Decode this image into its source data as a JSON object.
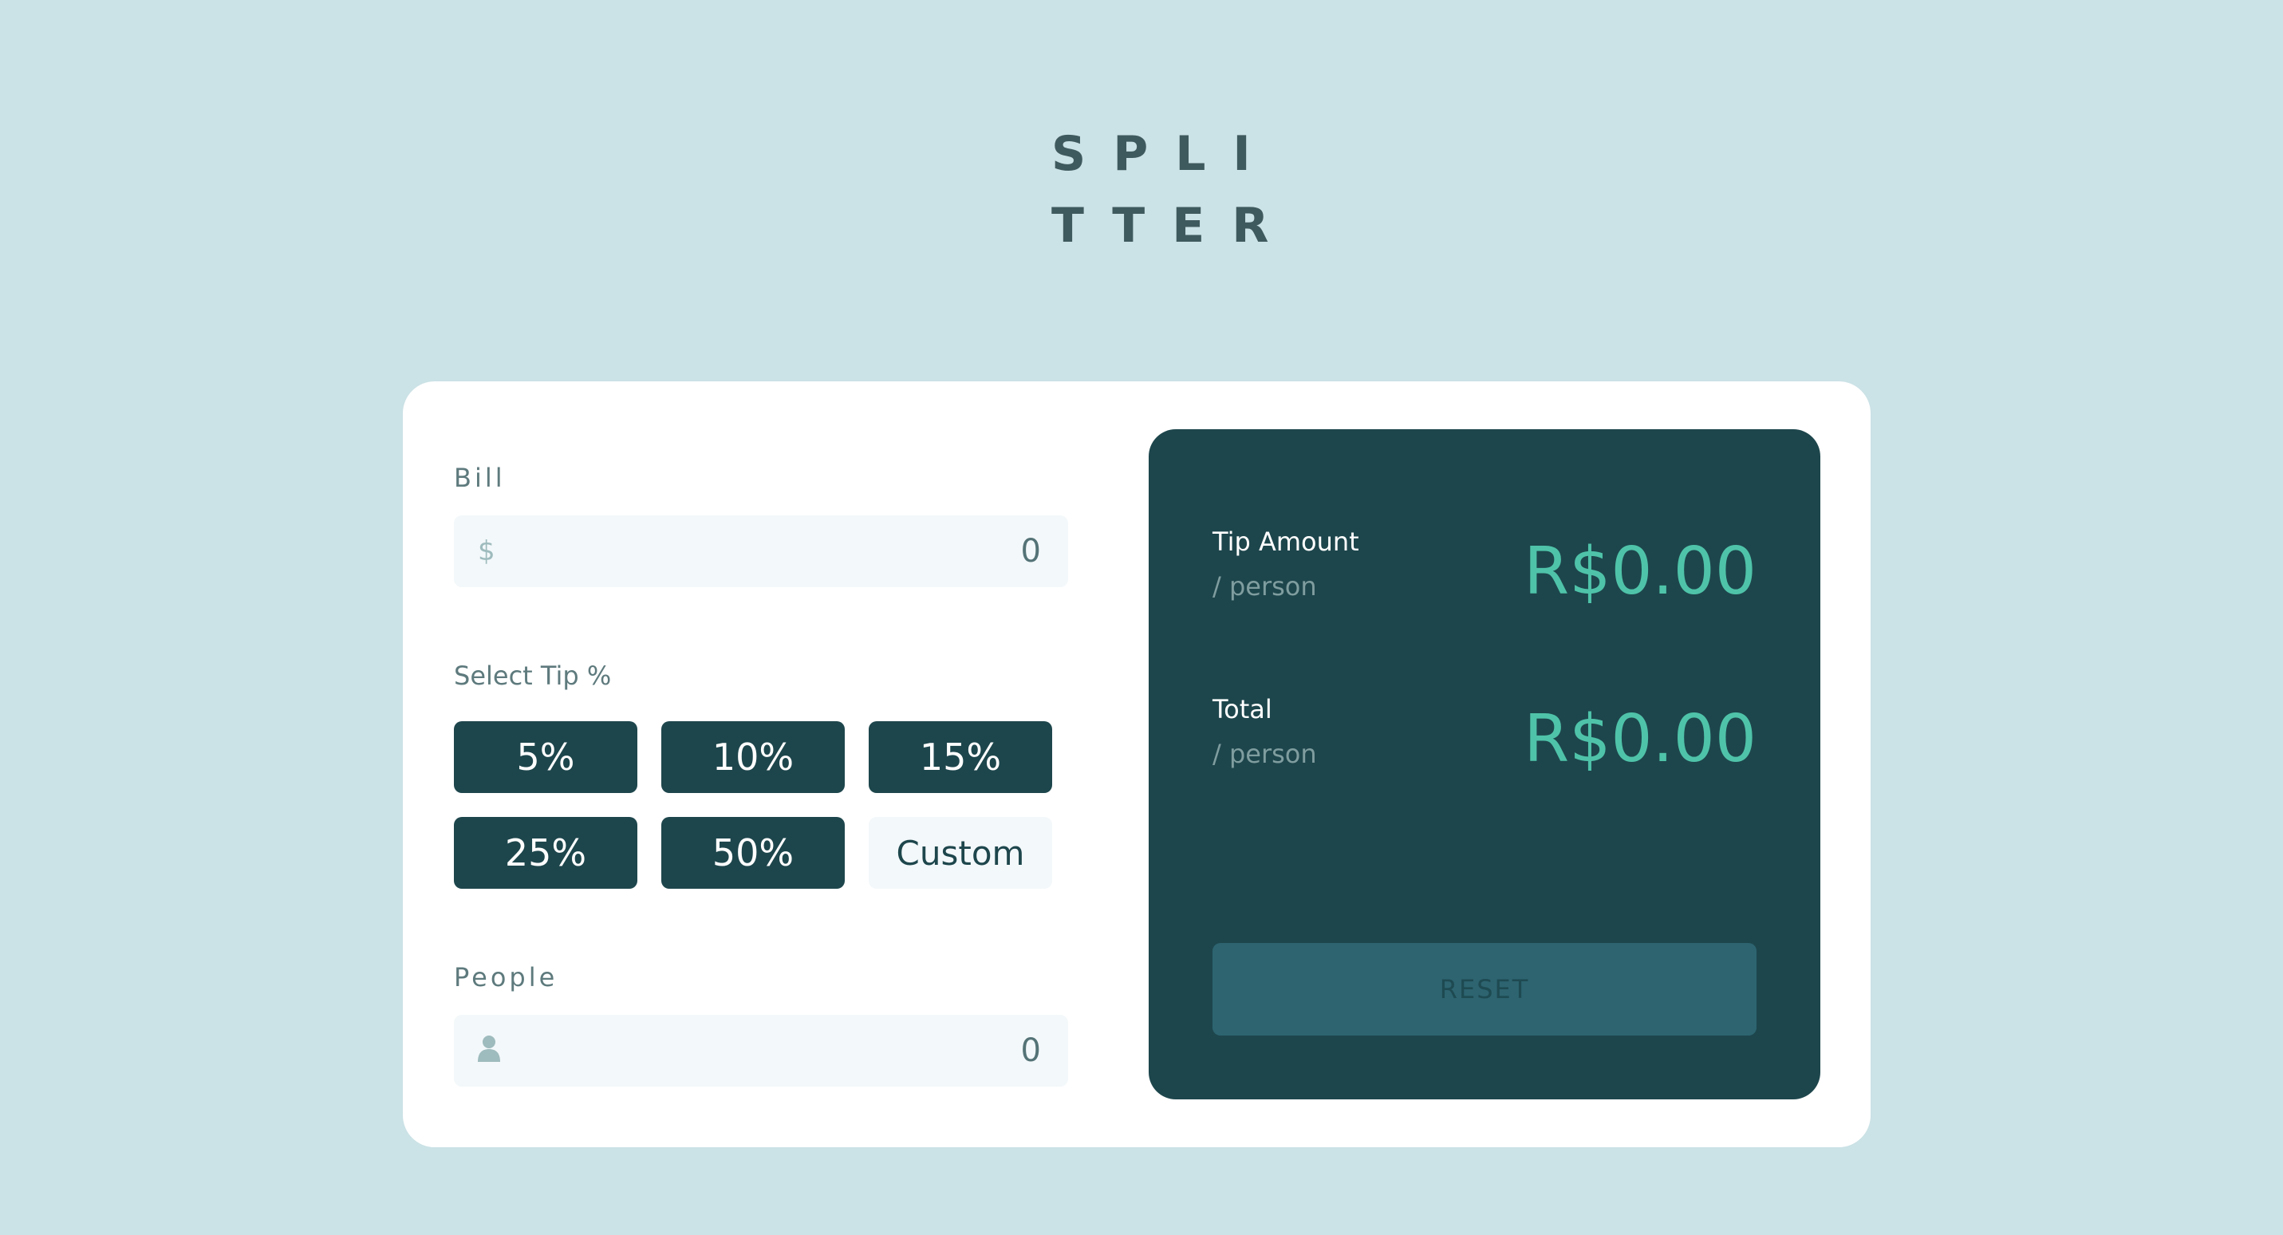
{
  "logo": {
    "line1": "SPLI",
    "line2": "TTER"
  },
  "form": {
    "bill_label": "Bill",
    "bill_icon": "$",
    "bill_value": "0",
    "tip_label": "Select Tip %",
    "tips": [
      "5%",
      "10%",
      "15%",
      "25%",
      "50%"
    ],
    "custom_placeholder": "Custom",
    "people_label": "People",
    "people_value": "0"
  },
  "result": {
    "tip_title": "Tip Amount",
    "tip_sub": "/ person",
    "tip_value": "R$0.00",
    "total_title": "Total",
    "total_sub": "/ person",
    "total_value": "R$0.00",
    "reset_label": "RESET"
  },
  "colors": {
    "background": "#cbe2e6",
    "dark_cyan": "#1d464c",
    "accent": "#4fc3a9"
  }
}
